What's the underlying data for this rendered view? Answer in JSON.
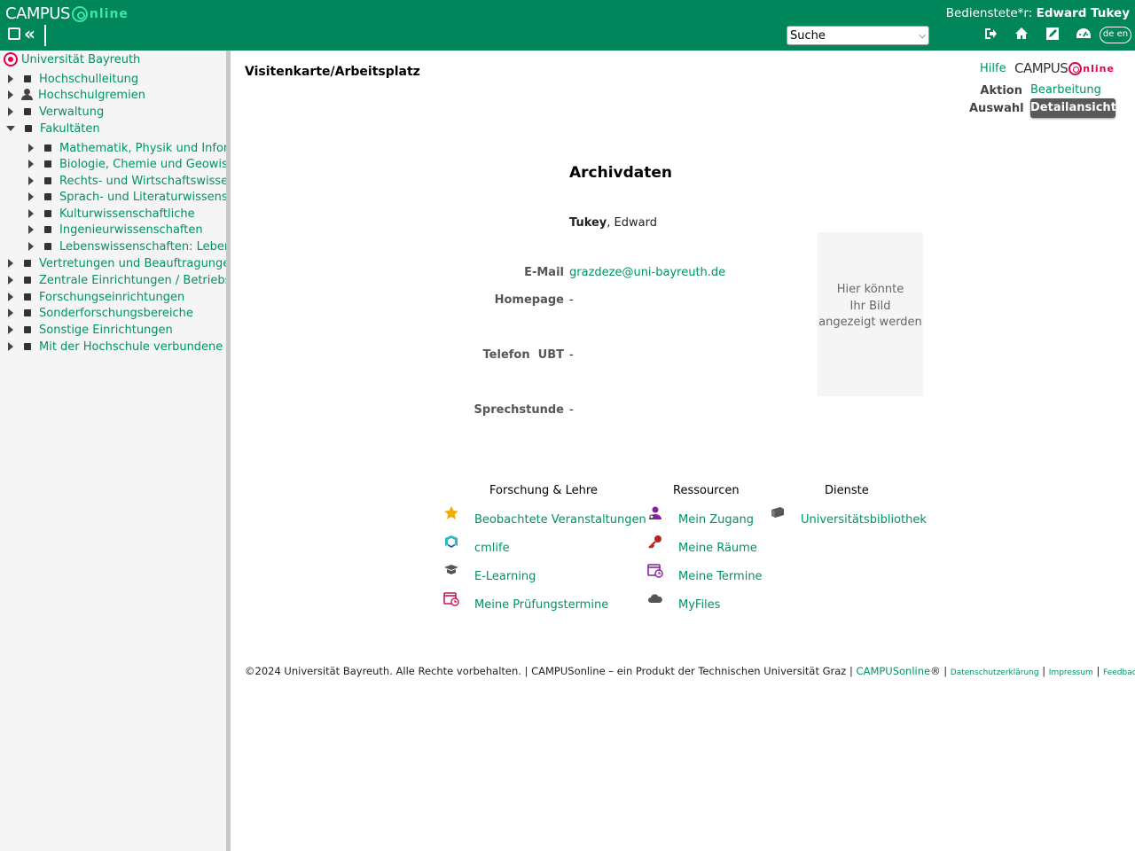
{
  "header": {
    "logo_text": "CAMPUS",
    "logo_online": "nline",
    "role_label": "Bedienstete*r:",
    "user_name": "Edward Tukey",
    "search_value": "Suche",
    "lang_label": "de en",
    "accent_color": "#00865a"
  },
  "sidebar": {
    "root": "Universität Bayreuth",
    "items": [
      {
        "label": "Hochschulleitung"
      },
      {
        "label": "Hochschulgremien"
      },
      {
        "label": "Verwaltung"
      },
      {
        "label": "Fakultäten"
      },
      {
        "label": "Mathematik, Physik und Informatik"
      },
      {
        "label": "Biologie, Chemie und Geowissenschaften"
      },
      {
        "label": "Rechts- und Wirtschaftswissenschaften"
      },
      {
        "label": "Sprach- und Literaturwissenschaften"
      },
      {
        "label": "Kulturwissenschaftliche"
      },
      {
        "label": "Ingenieurwissenschaften"
      },
      {
        "label": "Lebenswissenschaften: Lebensmittel, Ernährung und Gesundheit"
      },
      {
        "label": "Vertretungen und Beauftragungen"
      },
      {
        "label": "Zentrale Einrichtungen / Betriebseinheiten"
      },
      {
        "label": "Forschungseinrichtungen"
      },
      {
        "label": "Sonderforschungsbereiche"
      },
      {
        "label": "Sonstige Einrichtungen"
      },
      {
        "label": "Mit der Hochschule verbundene Einrichtungen"
      }
    ]
  },
  "main": {
    "page_title": "Visitenkarte/Arbeitsplatz",
    "help": "Hilfe",
    "co_logo_text": "CAMPUS",
    "co_logo_online": "nline",
    "aktion_label": "Aktion",
    "aktion_value": "Bearbeitung",
    "auswahl_label": "Auswahl",
    "auswahl_value": "Detailansicht",
    "section_title": "Archivdaten",
    "last_name": "Tukey",
    "first_name": ", Edward",
    "email_label": "E-Mail",
    "email_value": "grazdeze@uni-bayreuth.de",
    "homepage_label": "Homepage",
    "homepage_value": "-",
    "phone_label": "Telefon  UBT",
    "phone_value": "-",
    "office_label": "Sprechstunde",
    "office_value": "-",
    "photo_placeholder_1": "Hier könnte",
    "photo_placeholder_2": "Ihr Bild",
    "photo_placeholder_3": "angezeigt werden"
  },
  "links": {
    "col1_title": "Forschung & Lehre",
    "col2_title": "Ressourcen",
    "col3_title": "Dienste",
    "col1": [
      {
        "label": "Beobachtete Veranstaltungen",
        "icon": "star-icon"
      },
      {
        "label": "cmlife",
        "icon": "cmlife-icon"
      },
      {
        "label": "E-Learning",
        "icon": "graduation-icon"
      },
      {
        "label": "Meine Prüfungstermine",
        "icon": "exam-calendar-icon"
      }
    ],
    "col2": [
      {
        "label": "Mein Zugang",
        "icon": "user-key-icon"
      },
      {
        "label": "Meine Räume",
        "icon": "key-icon"
      },
      {
        "label": "Meine Termine",
        "icon": "calendar-icon"
      },
      {
        "label": "MyFiles",
        "icon": "cloud-icon"
      }
    ],
    "col3": [
      {
        "label": "Universitätsbibliothek",
        "icon": "books-icon"
      }
    ]
  },
  "footer": {
    "copyright": "©2024 Universität Bayreuth. Alle Rechte vorbehalten. | CAMPUSonline – ein Produkt der Technischen Universität Graz | ",
    "co_link": "CAMPUSonline",
    "reg": "® | ",
    "privacy": "Datenschutzerklärung",
    "sep1": " | ",
    "imprint": "Impressum",
    "sep2": " | ",
    "feedback": "Feedback"
  }
}
